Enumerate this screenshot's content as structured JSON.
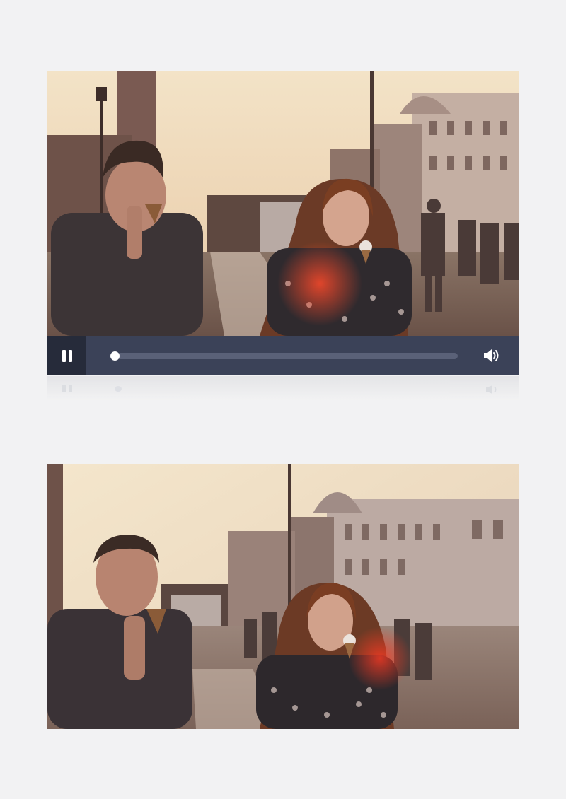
{
  "player": {
    "state": "playing",
    "progress_fraction": 0.0,
    "colors": {
      "controls_bg": "#3b4258",
      "button_bg": "#262b3a",
      "track": "#5a6178",
      "knob": "#ffffff"
    },
    "icons": {
      "play_pause": "pause-icon",
      "volume": "volume-icon"
    }
  }
}
